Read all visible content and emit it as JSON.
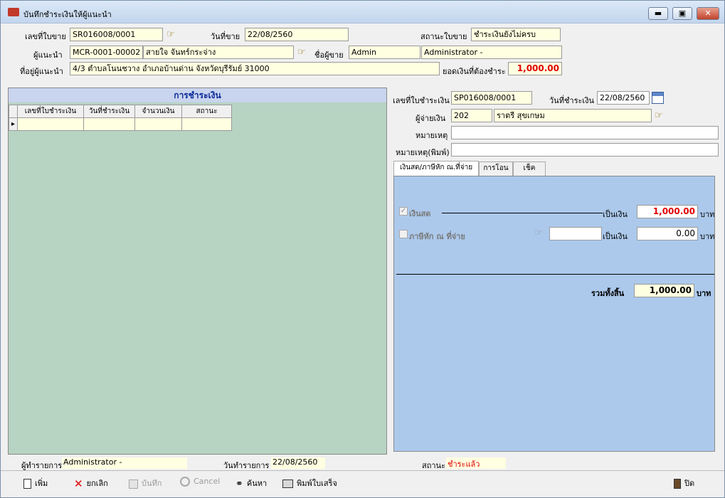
{
  "window": {
    "title": "บันทึกชำระเงินให้ผู้แนะนำ",
    "min": "▬",
    "max": "▣",
    "close": "✕"
  },
  "header": {
    "sale_no_label": "เลขที่ใบขาย",
    "sale_no": "SR016008/0001",
    "date_label": "วันที่ขาย",
    "date": "22/08/2560",
    "status_label": "สถานะใบขาย",
    "status": "ชำระเงินยังไม่ครบ",
    "referrer_label": "ผู้แนะนำ",
    "referrer_code": "MCR-0001-00002",
    "referrer_name": "สายใจ จันทร์กระจ่าง",
    "seller_label": "ชื่อผู้ขาย",
    "seller_code": "Admin",
    "seller_name": "Administrator -",
    "address_label": "ที่อยู่ผู้แนะนำ",
    "address": "4/3 ตำบลโนนชวาง อำเภอบ้านด่าน จังหวัดบุรีรัมย์ 31000",
    "due_label": "ยอดเงินที่ต้องชำระ",
    "due": "1,000.00"
  },
  "payments_panel": {
    "title": "การชำระเงิน",
    "columns": [
      "เลขที่ใบชำระเงิน",
      "วันที่ชำระเงิน",
      "จำนวนเงิน",
      "สถานะ"
    ]
  },
  "payment": {
    "pay_no_label": "เลขที่ใบชำระเงิน",
    "pay_no": "SP016008/0001",
    "pay_date_label": "วันที่ชำระเงิน",
    "pay_date": "22/08/2560",
    "payer_label": "ผู้จ่ายเงิน",
    "payer_code": "202",
    "payer_name": "ราตรี สุขเกษม",
    "note_label": "หมายเหตุ",
    "note": "",
    "note_print_label": "หมายเหตุ(พิมพ์)",
    "note_print": ""
  },
  "tabs": [
    "เงินสด/ภาษีหัก ณ.ที่จ่าย",
    "การโอน",
    "เช็ค"
  ],
  "cash": {
    "cash_label": "เงินสด",
    "cash_amount_label": "เป็นเงิน",
    "cash_amount": "1,000.00",
    "baht": "บาท",
    "wht_label": "ภาษีหัก ณ ที่จ่าย",
    "wht_rate": "",
    "wht_amount_label": "เป็นเงิน",
    "wht_amount": "0.00",
    "total_label": "รวมทั้งสิ้น",
    "total": "1,000.00"
  },
  "status_bar": {
    "operator_label": "ผู้ทำรายการ",
    "operator": "Administrator -",
    "op_date_label": "วันทำรายการ",
    "op_date": "22/08/2560",
    "state_label": "สถานะ",
    "state": "ชำระแล้ว"
  },
  "toolbar": {
    "add": "เพิ่ม",
    "cancel_th": "ยกเลิก",
    "save": "บันทึก",
    "cancel": "Cancel",
    "search": "ค้นหา",
    "print": "พิมพ์ใบเสร็จ",
    "close": "ปิด"
  },
  "colors": {
    "accent": "#0b2a9a",
    "alert": "#e00000",
    "field": "#ffffe1",
    "panel_green": "#b7d3c2",
    "panel_blue": "#acc9ec"
  }
}
